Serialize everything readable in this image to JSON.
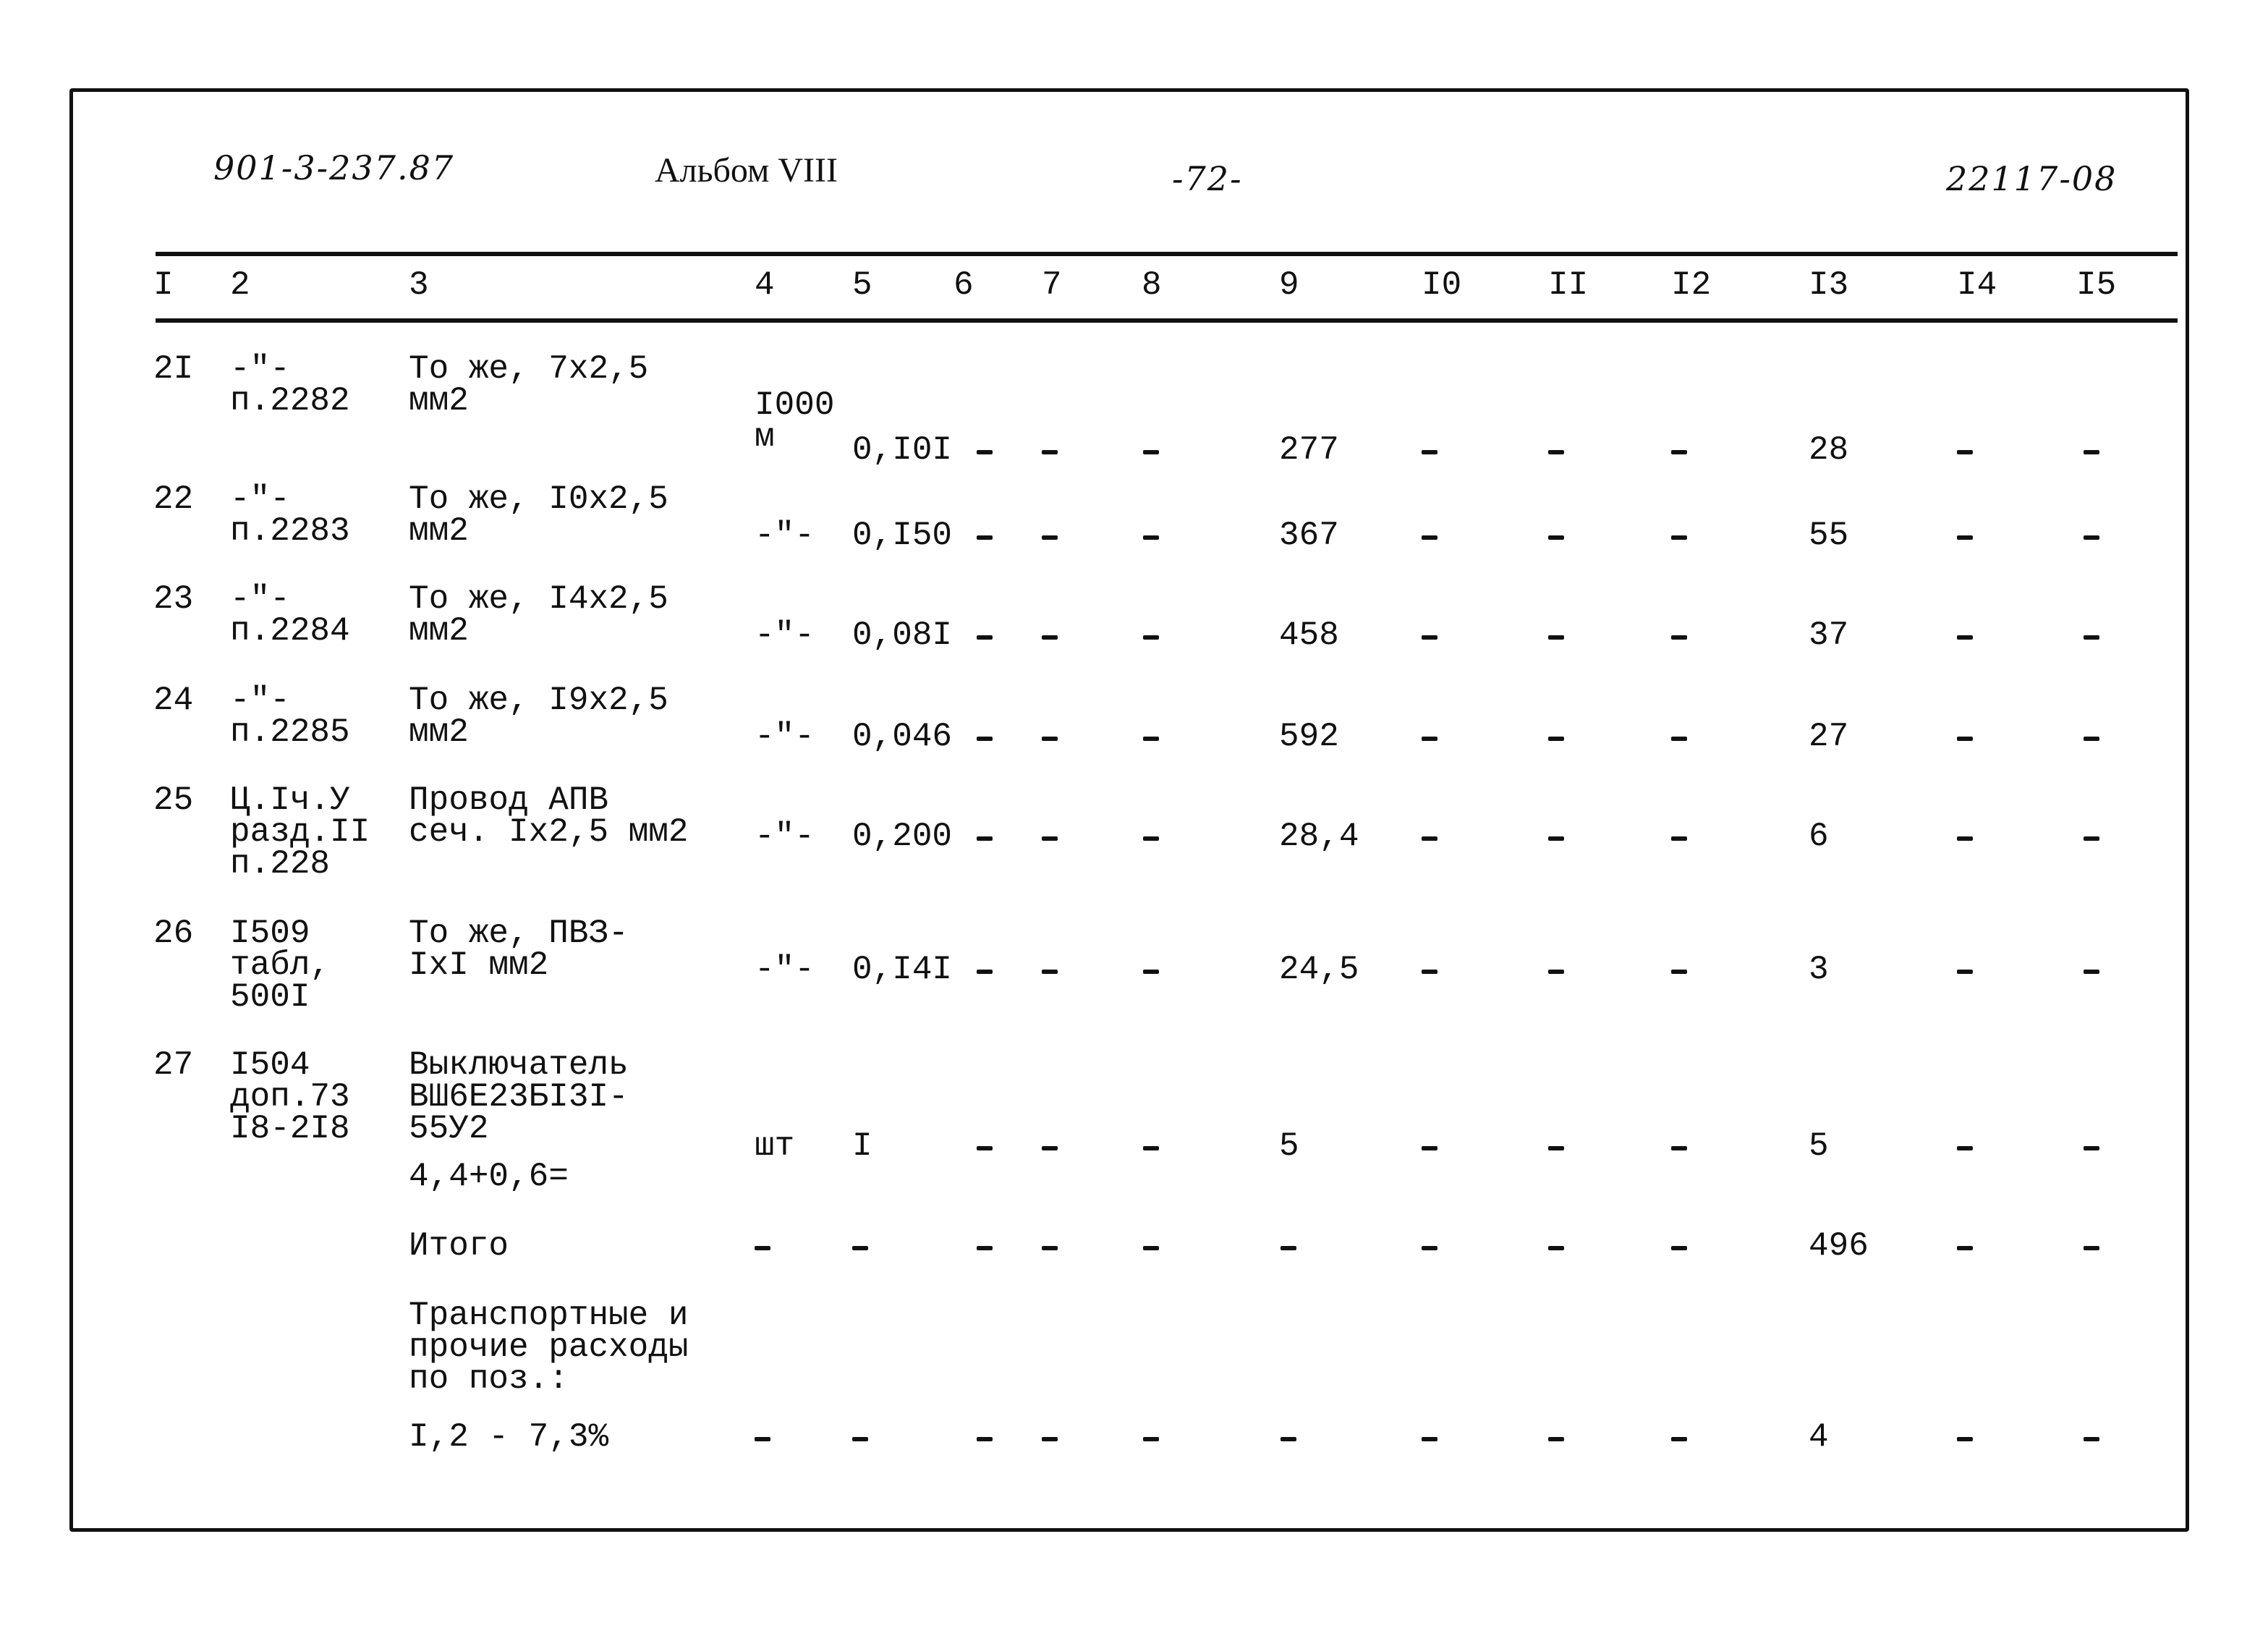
{
  "header": {
    "doc_number": "901-3-237.87",
    "album": "Альбом VIII",
    "page": "-72-",
    "code": "22117-08"
  },
  "columns": [
    "I",
    "2",
    "3",
    "4",
    "5",
    "6",
    "7",
    "8",
    "9",
    "I0",
    "II",
    "I2",
    "I3",
    "I4",
    "I5"
  ],
  "rows": [
    {
      "no": "2I",
      "ref": [
        "-\"-",
        "п.2282"
      ],
      "desc": [
        "То же, 7х2,5",
        "мм2"
      ],
      "unit": [
        "I000",
        "м"
      ],
      "c5": "0,I0I",
      "c6": "–",
      "c7": "–",
      "c8": "–",
      "c9": "277",
      "c10": "–",
      "c11": "–",
      "c12": "–",
      "c13": "28",
      "c14": "–",
      "c15": "–"
    },
    {
      "no": "22",
      "ref": [
        "-\"-",
        "п.2283"
      ],
      "desc": [
        "То же, I0х2,5",
        "мм2"
      ],
      "unit": [
        "-\"-"
      ],
      "c5": "0,I50",
      "c6": "–",
      "c7": "–",
      "c8": "–",
      "c9": "367",
      "c10": "–",
      "c11": "–",
      "c12": "–",
      "c13": "55",
      "c14": "–",
      "c15": "–"
    },
    {
      "no": "23",
      "ref": [
        "-\"-",
        "п.2284"
      ],
      "desc": [
        "То же, I4х2,5",
        "мм2"
      ],
      "unit": [
        "-\"-"
      ],
      "c5": "0,08I",
      "c6": "–",
      "c7": "–",
      "c8": "–",
      "c9": "458",
      "c10": "–",
      "c11": "–",
      "c12": "–",
      "c13": "37",
      "c14": "–",
      "c15": "–"
    },
    {
      "no": "24",
      "ref": [
        "-\"-",
        "п.2285"
      ],
      "desc": [
        "То же, I9х2,5",
        "мм2"
      ],
      "unit": [
        "-\"-"
      ],
      "c5": "0,046",
      "c6": "–",
      "c7": "–",
      "c8": "–",
      "c9": "592",
      "c10": "–",
      "c11": "–",
      "c12": "–",
      "c13": "27",
      "c14": "–",
      "c15": "–"
    },
    {
      "no": "25",
      "ref": [
        "Ц.Iч.У",
        "разд.II",
        "п.228"
      ],
      "desc": [
        "Провод АПВ",
        "сеч. Iх2,5 мм2"
      ],
      "unit": [
        "-\"-"
      ],
      "c5": "0,200",
      "c6": "–",
      "c7": "–",
      "c8": "–",
      "c9": "28,4",
      "c10": "–",
      "c11": "–",
      "c12": "–",
      "c13": "6",
      "c14": "–",
      "c15": "–"
    },
    {
      "no": "26",
      "ref": [
        "I509",
        "табл,",
        "500I"
      ],
      "desc": [
        "То же, ПВЗ-",
        "IхI мм2"
      ],
      "unit": [
        "-\"-"
      ],
      "c5": "0,I4I",
      "c6": "–",
      "c7": "–",
      "c8": "–",
      "c9": "24,5",
      "c10": "–",
      "c11": "–",
      "c12": "–",
      "c13": "3",
      "c14": "–",
      "c15": "–"
    },
    {
      "no": "27",
      "ref": [
        "I504",
        "доп.73",
        "I8-2I8"
      ],
      "desc": [
        "Выключатель",
        "ВШ6Е23БI3I-",
        "55У2"
      ],
      "desc_extra": "4,4+0,6=",
      "unit": [
        "шт"
      ],
      "c5": "I",
      "c6": "–",
      "c7": "–",
      "c8": "–",
      "c9": "5",
      "c10": "–",
      "c11": "–",
      "c12": "–",
      "c13": "5",
      "c14": "–",
      "c15": "–"
    }
  ],
  "total": {
    "label": "Итого",
    "c13": "496"
  },
  "transport": {
    "label": [
      "Транспортные и",
      "прочие расходы",
      "по поз.:"
    ],
    "sub_label": "I,2 - 7,3%",
    "c13": "4"
  }
}
